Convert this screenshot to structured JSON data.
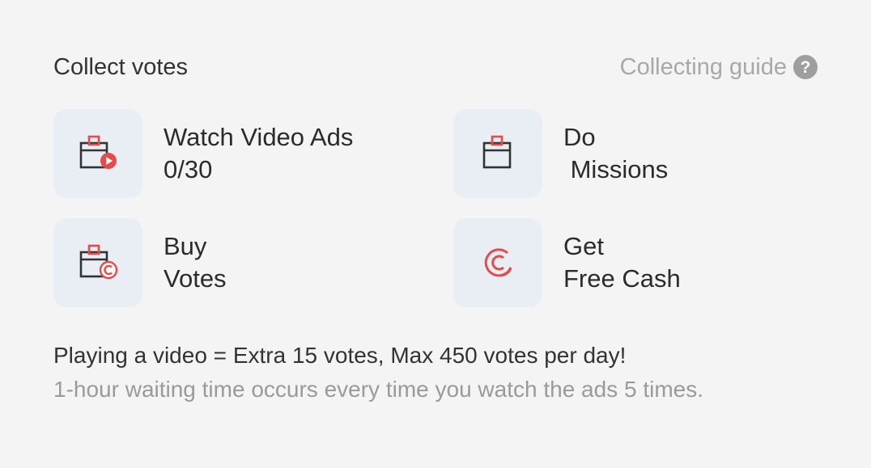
{
  "header": {
    "title": "Collect votes",
    "guide_label": "Collecting guide",
    "guide_icon": "?"
  },
  "options": {
    "watch": {
      "line1": "Watch Video Ads",
      "line2": "0/30",
      "icon": "calendar-play-icon"
    },
    "missions": {
      "line1": "Do",
      "line2": " Missions",
      "icon": "calendar-icon"
    },
    "buy": {
      "line1": "Buy",
      "line2": "Votes",
      "icon": "calendar-coin-icon"
    },
    "cash": {
      "line1": "Get",
      "line2": "Free Cash",
      "icon": "cash-coin-icon"
    }
  },
  "note": {
    "main": "Playing a video = Extra 15 votes, Max 450 votes per day!",
    "sub": "1-hour waiting time occurs every time you watch the ads 5 times."
  },
  "colors": {
    "accent_red": "#e54b4b",
    "tile_bg": "#e9eef5",
    "icon_stroke": "#333333"
  }
}
